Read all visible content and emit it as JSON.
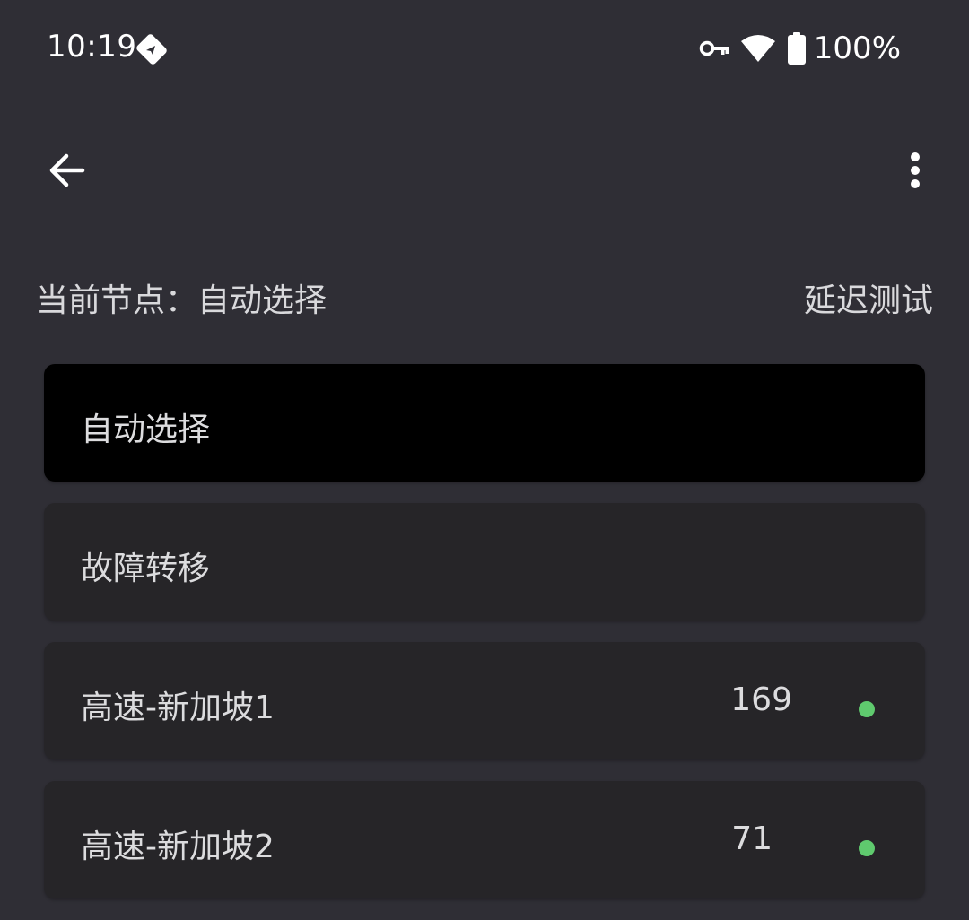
{
  "status_bar": {
    "time": "10:19",
    "app_icon": "tag-send-icon",
    "vpn_icon": "key-icon",
    "wifi_icon": "wifi-icon",
    "battery_icon": "battery-icon",
    "battery_level": "100%"
  },
  "app_bar": {
    "back_icon": "arrow-left-icon",
    "more_icon": "more-vert-icon"
  },
  "current": {
    "label": "当前节点：自动选择",
    "latency_test_label": "延迟测试"
  },
  "nodes": [
    {
      "name": "自动选择",
      "delay": "",
      "selected": true,
      "dot": false
    },
    {
      "name": "故障转移",
      "delay": "",
      "selected": false,
      "dot": false
    },
    {
      "name": "高速-新加坡1",
      "delay": "169",
      "selected": false,
      "dot": true
    },
    {
      "name": "高速-新加坡2",
      "delay": "71",
      "selected": false,
      "dot": true
    }
  ],
  "colors": {
    "background": "#2f2e35",
    "card": "#262528",
    "card_selected": "#000000",
    "status_dot_green": "#5fca6e"
  }
}
